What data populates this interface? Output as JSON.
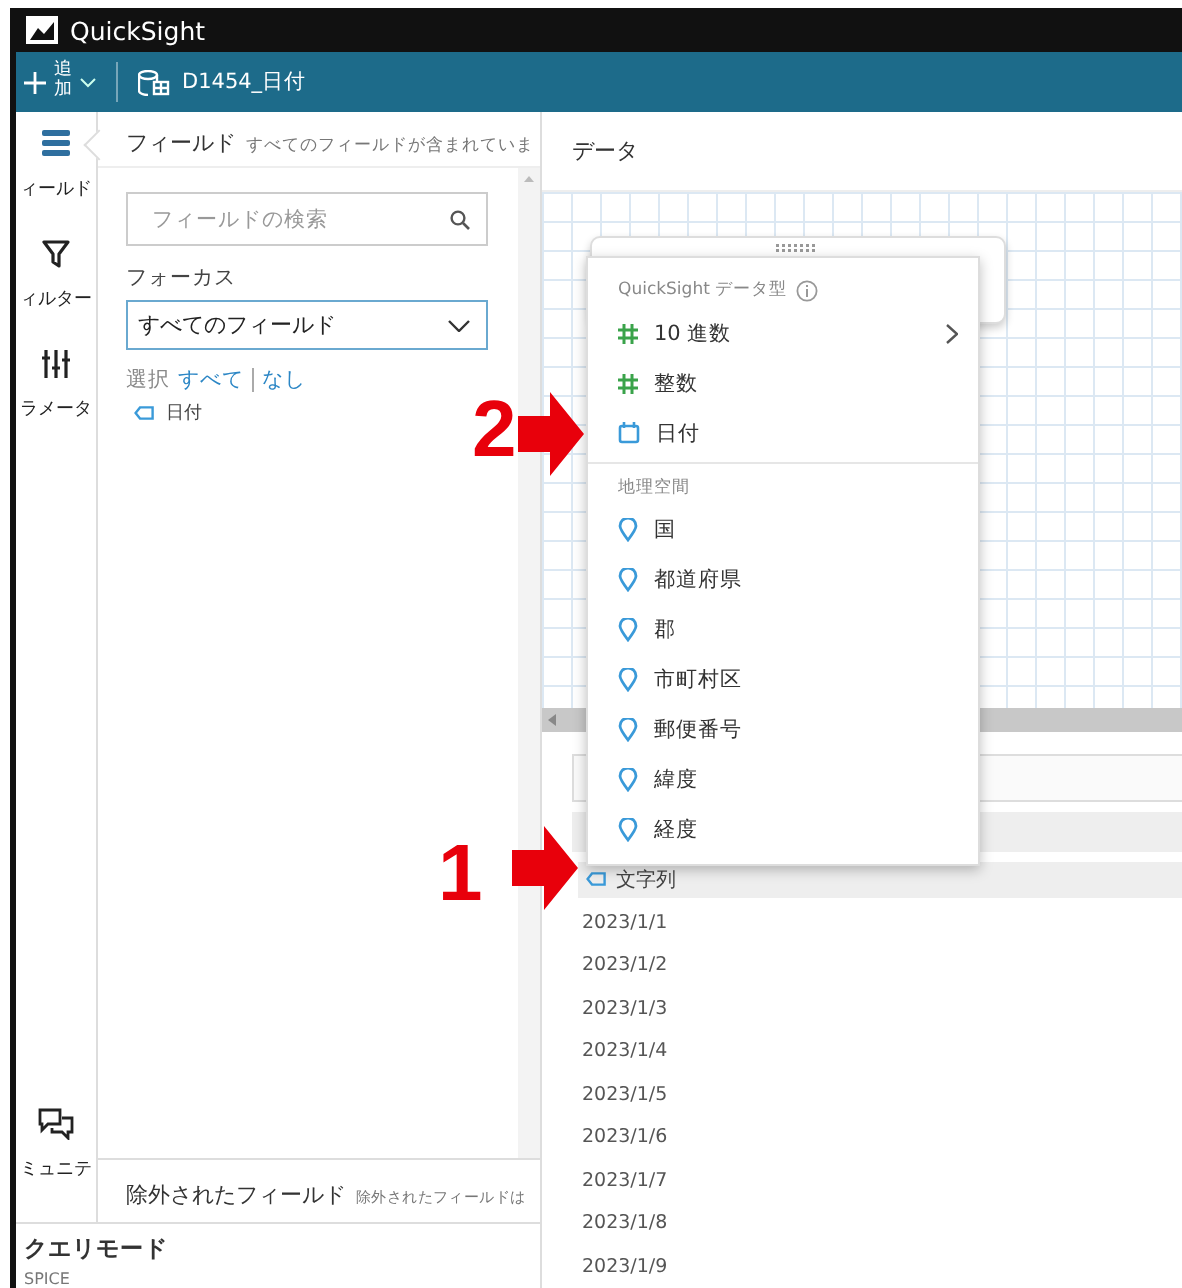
{
  "app": {
    "title": "QuickSight"
  },
  "toolbar": {
    "add_label": "追加",
    "dataset": "D1454_日付"
  },
  "rail": {
    "items": [
      {
        "kind": "fields",
        "label": "ィールド",
        "selected": true
      },
      {
        "kind": "filter",
        "label": "ィルター",
        "selected": false
      },
      {
        "kind": "parameters",
        "label": "ラメータ",
        "selected": false
      }
    ],
    "bottom_items": [
      {
        "kind": "community",
        "label": "ミュニテ",
        "selected": false
      }
    ]
  },
  "field_panel": {
    "title": "フィールド",
    "subtitle": "すべてのフィールドが含まれていま",
    "search": {
      "placeholder": "フィールドの検索"
    },
    "focus_label": "フォーカス",
    "focus_value": "すべてのフィールド",
    "select_label": "選択",
    "select_all": "すべて",
    "select_none": "なし",
    "fields": [
      {
        "name": "日付"
      }
    ]
  },
  "excluded": {
    "title": "除外されたフィールド",
    "subtitle": "除外されたフィールドは"
  },
  "query_mode": {
    "title": "クエリモード",
    "value": "SPICE"
  },
  "data_panel": {
    "title": "データ",
    "column_header": "文字列",
    "rows": [
      "2023/1/1",
      "2023/1/2",
      "2023/1/3",
      "2023/1/4",
      "2023/1/5",
      "2023/1/6",
      "2023/1/7",
      "2023/1/8",
      "2023/1/9"
    ]
  },
  "type_menu": {
    "title": "QuickSight データ型",
    "sections": [
      {
        "items": [
          {
            "kind": "number",
            "label": "10 進数",
            "submenu": true
          },
          {
            "kind": "number",
            "label": "整数",
            "submenu": false
          },
          {
            "kind": "date",
            "label": "日付",
            "submenu": false
          }
        ]
      },
      {
        "title": "地理空間",
        "items": [
          {
            "kind": "geo",
            "label": "国",
            "submenu": false
          },
          {
            "kind": "geo",
            "label": "都道府県",
            "submenu": false
          },
          {
            "kind": "geo",
            "label": "郡",
            "submenu": false
          },
          {
            "kind": "geo",
            "label": "市町村区",
            "submenu": false
          },
          {
            "kind": "geo",
            "label": "郵便番号",
            "submenu": false
          },
          {
            "kind": "geo",
            "label": "緯度",
            "submenu": false
          },
          {
            "kind": "geo",
            "label": "経度",
            "submenu": false
          }
        ]
      }
    ]
  },
  "annotations": [
    {
      "number": "2"
    },
    {
      "number": "1"
    }
  ]
}
